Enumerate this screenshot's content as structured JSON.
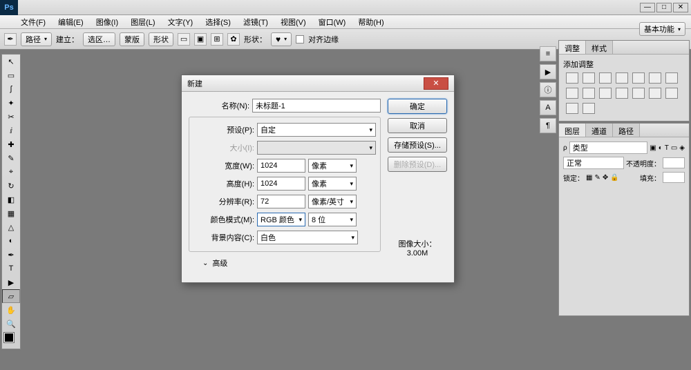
{
  "app": {
    "logo": "Ps"
  },
  "menu": [
    "文件(F)",
    "编辑(E)",
    "图像(I)",
    "图层(L)",
    "文字(Y)",
    "选择(S)",
    "滤镜(T)",
    "视图(V)",
    "窗口(W)",
    "帮助(H)"
  ],
  "options": {
    "dropdown1": "路径",
    "label_build": "建立：",
    "btn_selection": "选区…",
    "btn_mask": "蒙版",
    "btn_shape": "形状",
    "label_shape": "形状：",
    "check_align": "对齐边缘",
    "essentials": "基本功能"
  },
  "panels": {
    "adjustments": {
      "tab1": "调整",
      "tab2": "样式",
      "title": "添加调整"
    },
    "layers": {
      "tab1": "图层",
      "tab2": "通道",
      "tab3": "路径",
      "kind": "类型",
      "blend": "正常",
      "opacity_label": "不透明度：",
      "lock_label": "锁定：",
      "fill_label": "填充："
    }
  },
  "dialog": {
    "title": "新建",
    "name_label": "名称(N):",
    "name_value": "未标题-1",
    "preset_label": "预设(P):",
    "preset_value": "自定",
    "size_label": "大小(I):",
    "width_label": "宽度(W):",
    "width_value": "1024",
    "width_unit": "像素",
    "height_label": "高度(H):",
    "height_value": "1024",
    "height_unit": "像素",
    "res_label": "分辨率(R):",
    "res_value": "72",
    "res_unit": "像素/英寸",
    "mode_label": "颜色模式(M):",
    "mode_value": "RGB 颜色",
    "depth_value": "8 位",
    "bg_label": "背景内容(C):",
    "bg_value": "白色",
    "advanced_label": "高级",
    "btn_ok": "确定",
    "btn_cancel": "取消",
    "btn_save": "存储预设(S)...",
    "btn_delete": "删除预设(D)...",
    "imgsize_label": "图像大小：",
    "imgsize_value": "3.00M"
  }
}
